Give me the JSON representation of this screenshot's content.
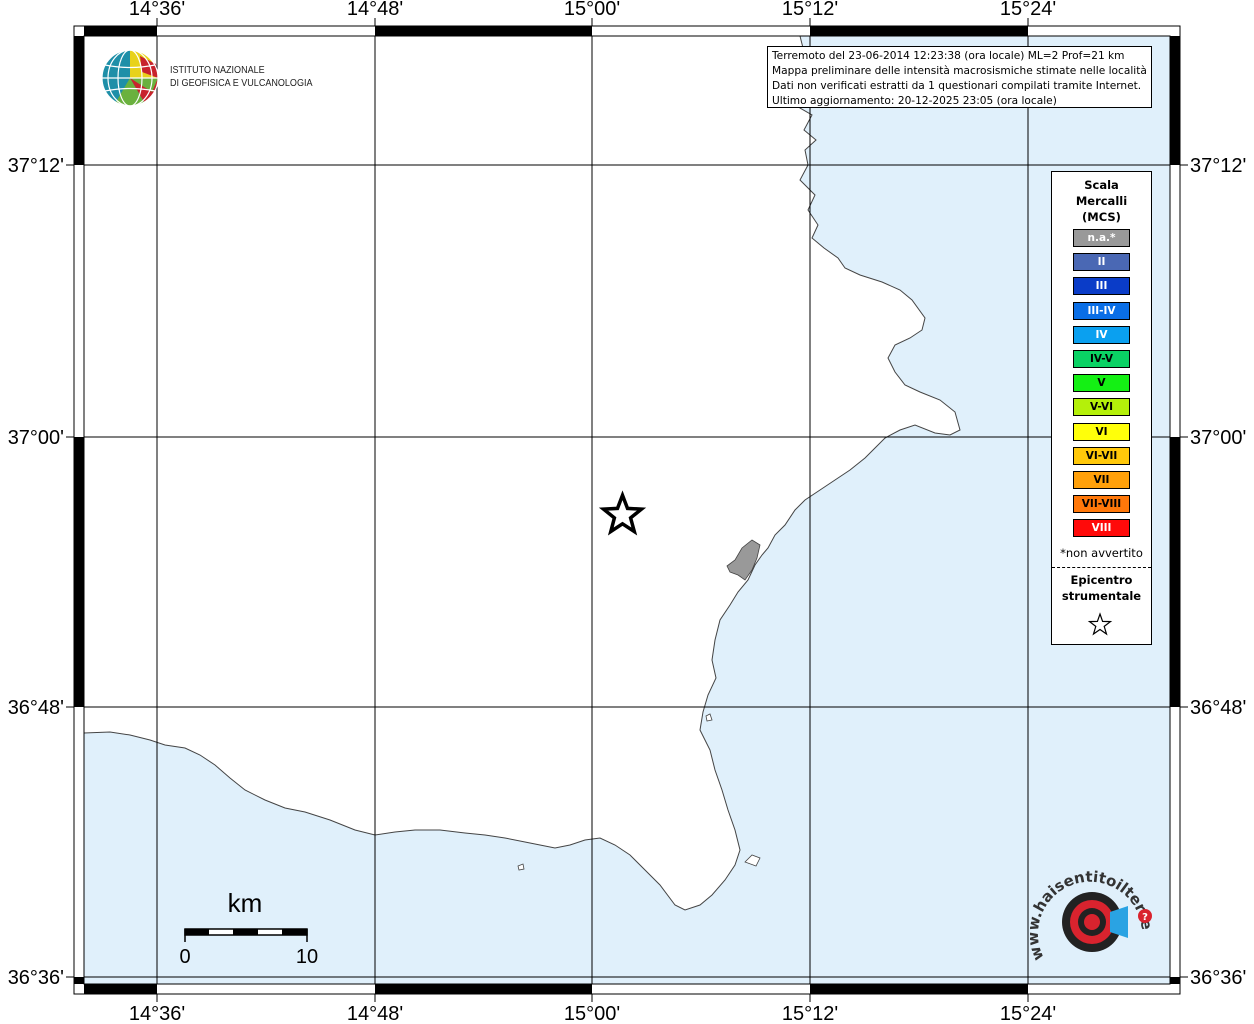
{
  "info_box": {
    "lines": [
      "Terremoto del 23-06-2014 12:23:38 (ora locale) ML=2 Prof=21 km",
      "Mappa preliminare delle intensità macrosismiche stimate nelle località",
      "Dati non verificati estratti da 1 questionari compilati tramite Internet.",
      "Ultimo aggiornamento: 20-12-2025 23:05 (ora locale)"
    ]
  },
  "logo_ingv": {
    "line1": "ISTITUTO NAZIONALE",
    "line2": "DI GEOFISICA E VULCANOLOGIA"
  },
  "axes": {
    "lon_ticks": [
      "14°36'",
      "14°48'",
      "15°00'",
      "15°12'",
      "15°24'"
    ],
    "lat_ticks": [
      "37°12'",
      "37°00'",
      "36°48'",
      "36°36'"
    ]
  },
  "legend": {
    "title_lines": [
      "Scala",
      "Mercalli",
      "(MCS)"
    ],
    "items": [
      {
        "label": "n.a.*",
        "color": "#999999",
        "text_color": "#ffffff"
      },
      {
        "label": "II",
        "color": "#4a68b4",
        "text_color": "#ffffff"
      },
      {
        "label": "III",
        "color": "#0a3cc8",
        "text_color": "#ffffff"
      },
      {
        "label": "III-IV",
        "color": "#0a6ee6",
        "text_color": "#ffffff"
      },
      {
        "label": "IV",
        "color": "#0aa0f0",
        "text_color": "#ffffff"
      },
      {
        "label": "IV-V",
        "color": "#0ad264",
        "text_color": "#000000"
      },
      {
        "label": "V",
        "color": "#14f014",
        "text_color": "#000000"
      },
      {
        "label": "V-VI",
        "color": "#b4f00a",
        "text_color": "#000000"
      },
      {
        "label": "VI",
        "color": "#ffff0a",
        "text_color": "#000000"
      },
      {
        "label": "VI-VII",
        "color": "#ffc80a",
        "text_color": "#000000"
      },
      {
        "label": "VII",
        "color": "#ffa00a",
        "text_color": "#000000"
      },
      {
        "label": "VII-VIII",
        "color": "#ff780a",
        "text_color": "#000000"
      },
      {
        "label": "VIII",
        "color": "#ff0a0a",
        "text_color": "#ffffff"
      }
    ],
    "note": "*non avvertito",
    "epicenter_lines": [
      "Epicentro",
      "strumentale"
    ]
  },
  "scalebar": {
    "unit": "km",
    "min_label": "0",
    "max_label": "10"
  },
  "map_colors": {
    "sea": "#e0f0fb",
    "land": "#ffffff",
    "urban": "#999999",
    "grid": "#000000"
  },
  "epicenter": {
    "lon": 15.028,
    "lat": 36.942
  },
  "hsit_logo": {
    "text": "www.haisentitoilterremoto.it"
  }
}
